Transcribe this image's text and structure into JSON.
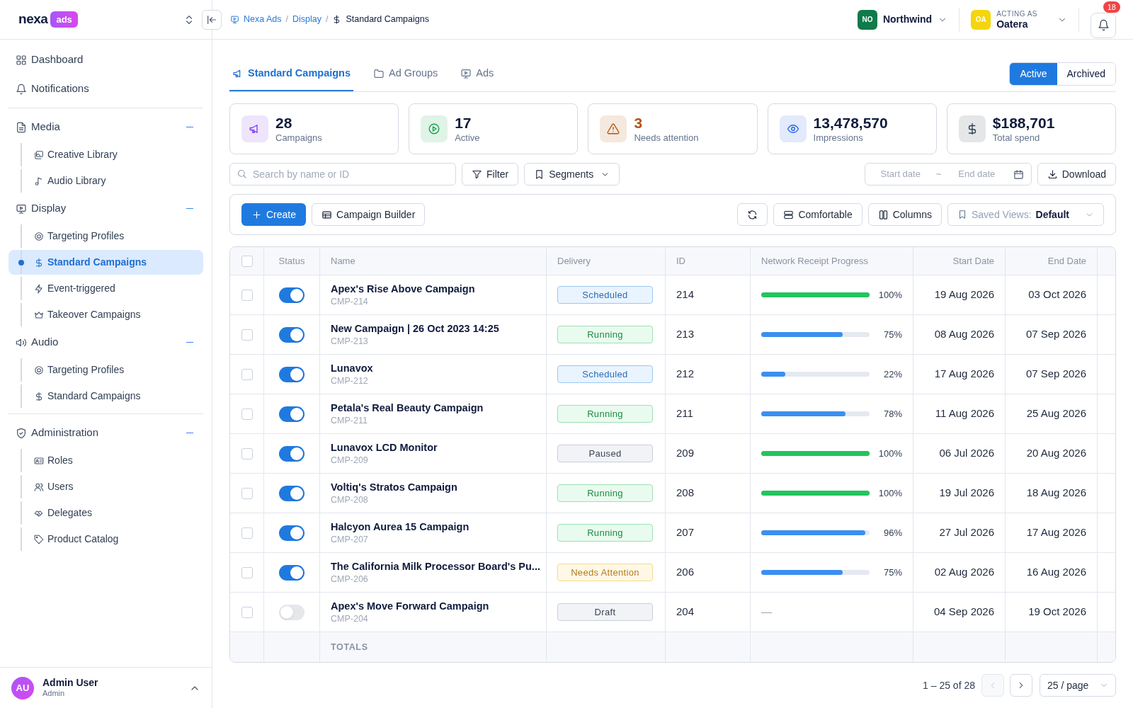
{
  "brand": {
    "name": "nexa",
    "badge": "ads"
  },
  "breadcrumb": [
    "Nexa Ads",
    "Display",
    "Standard Campaigns"
  ],
  "breadcrumb_separator": "/",
  "org": {
    "initials": "NO",
    "name": "Northwind",
    "color": "#0f7a4a"
  },
  "acting_as": {
    "initials": "OA",
    "caption": "ACTING AS",
    "name": "Oatera",
    "color": "#f5d50b"
  },
  "notifications": {
    "count": "18"
  },
  "sidebar": {
    "groups": [
      [
        {
          "label": "Dashboard",
          "selected": false
        },
        {
          "label": "Notifications",
          "selected": false
        }
      ],
      [
        {
          "label": "Media",
          "selected": false,
          "expanded": true,
          "children": [
            {
              "label": "Creative Library",
              "selected": false
            },
            {
              "label": "Audio Library",
              "selected": false
            }
          ]
        },
        {
          "label": "Display",
          "selected": false,
          "expanded": true,
          "children": [
            {
              "label": "Targeting Profiles",
              "selected": false
            },
            {
              "label": "Standard Campaigns",
              "selected": true
            },
            {
              "label": "Event-triggered",
              "selected": false
            },
            {
              "label": "Takeover Campaigns",
              "selected": false
            }
          ]
        },
        {
          "label": "Audio",
          "selected": false,
          "expanded": true,
          "children": [
            {
              "label": "Targeting Profiles",
              "selected": false
            },
            {
              "label": "Standard Campaigns",
              "selected": false
            }
          ]
        }
      ],
      [
        {
          "label": "Administration",
          "selected": false,
          "expanded": true,
          "children": [
            {
              "label": "Roles",
              "selected": false
            },
            {
              "label": "Users",
              "selected": false
            },
            {
              "label": "Delegates",
              "selected": false
            },
            {
              "label": "Product Catalog",
              "selected": false
            }
          ]
        }
      ]
    ],
    "user": {
      "initials": "AU",
      "name": "Admin User",
      "role": "Admin"
    }
  },
  "tabs": [
    {
      "label": "Standard Campaigns",
      "selected": true
    },
    {
      "label": "Ad Groups",
      "selected": false
    },
    {
      "label": "Ads",
      "selected": false
    }
  ],
  "archive_toggle": [
    {
      "label": "Active",
      "selected": true
    },
    {
      "label": "Archived",
      "selected": false
    }
  ],
  "stats": [
    {
      "value": "28",
      "label": "Campaigns",
      "color": "#7c3aed",
      "emphasis": false
    },
    {
      "value": "17",
      "label": "Active",
      "color": "#16a34a",
      "emphasis": false
    },
    {
      "value": "3",
      "label": "Needs attention",
      "color": "#b45309",
      "emphasis": true
    },
    {
      "value": "13,478,570",
      "label": "Impressions",
      "color": "#2563eb",
      "emphasis": false
    },
    {
      "value": "$188,701",
      "label": "Total spend",
      "color": "#334155",
      "emphasis": false
    }
  ],
  "filters": {
    "search": {
      "placeholder": "Search by name or ID"
    },
    "filter": "Filter",
    "segments": "Segments",
    "start_date": {
      "placeholder": "Start date"
    },
    "separator": "~",
    "end_date": {
      "placeholder": "End date"
    },
    "download": "Download"
  },
  "toolbar": {
    "create": "Create",
    "builder": "Campaign Builder",
    "density": "Comfortable",
    "columns": "Columns",
    "saved_views_label": "Saved Views:",
    "saved_views_value": "Default"
  },
  "table": {
    "select_all_checked": false,
    "columns": [
      "Status",
      "Name",
      "Delivery",
      "ID",
      "Network Receipt Progress",
      "Start Date",
      "End Date"
    ],
    "rows": [
      {
        "checked": false,
        "on": true,
        "name": "Apex's Rise Above Campaign",
        "code": "CMP-214",
        "delivery": {
          "kind": "scheduled",
          "label": "Scheduled"
        },
        "id": "214",
        "progress": {
          "level": 1,
          "reading": "100%"
        },
        "start": "19 Aug 2026",
        "end": "03 Oct 2026"
      },
      {
        "checked": false,
        "on": true,
        "name": "New Campaign | 26 Oct 2023 14:25",
        "code": "CMP-213",
        "delivery": {
          "kind": "running",
          "label": "Running"
        },
        "id": "213",
        "progress": {
          "level": 0.75,
          "reading": "75%"
        },
        "start": "08 Aug 2026",
        "end": "07 Sep 2026"
      },
      {
        "checked": false,
        "on": true,
        "name": "Lunavox",
        "code": "CMP-212",
        "delivery": {
          "kind": "scheduled",
          "label": "Scheduled"
        },
        "id": "212",
        "progress": {
          "level": 0.22,
          "reading": "22%"
        },
        "start": "17 Aug 2026",
        "end": "07 Sep 2026"
      },
      {
        "checked": false,
        "on": true,
        "name": "Petala's Real Beauty Campaign",
        "code": "CMP-211",
        "delivery": {
          "kind": "running",
          "label": "Running"
        },
        "id": "211",
        "progress": {
          "level": 0.78,
          "reading": "78%"
        },
        "start": "11 Aug 2026",
        "end": "25 Aug 2026"
      },
      {
        "checked": false,
        "on": true,
        "name": "Lunavox LCD Monitor",
        "code": "CMP-209",
        "delivery": {
          "kind": "paused",
          "label": "Paused"
        },
        "id": "209",
        "progress": {
          "level": 1,
          "reading": "100%"
        },
        "start": "06 Jul 2026",
        "end": "20 Aug 2026"
      },
      {
        "checked": false,
        "on": true,
        "name": "Voltiq's Stratos Campaign",
        "code": "CMP-208",
        "delivery": {
          "kind": "running",
          "label": "Running"
        },
        "id": "208",
        "progress": {
          "level": 1,
          "reading": "100%"
        },
        "start": "19 Jul 2026",
        "end": "18 Aug 2026"
      },
      {
        "checked": false,
        "on": true,
        "name": "Halcyon Aurea 15 Campaign",
        "code": "CMP-207",
        "delivery": {
          "kind": "running",
          "label": "Running"
        },
        "id": "207",
        "progress": {
          "level": 0.96,
          "reading": "96%"
        },
        "start": "27 Jul 2026",
        "end": "17 Aug 2026"
      },
      {
        "checked": false,
        "on": true,
        "name": "The California Milk Processor Board's Pu...",
        "code": "CMP-206",
        "delivery": {
          "kind": "needs_attention",
          "label": "Needs Attention"
        },
        "id": "206",
        "progress": {
          "level": 0.75,
          "reading": "75%"
        },
        "start": "02 Aug 2026",
        "end": "16 Aug 2026"
      },
      {
        "checked": false,
        "on": false,
        "name": "Apex's Move Forward Campaign",
        "code": "CMP-204",
        "delivery": {
          "kind": "draft",
          "label": "Draft"
        },
        "id": "204",
        "progress_empty": "—",
        "start": "04 Sep 2026",
        "end": "19 Oct 2026"
      }
    ],
    "totals_label": "TOTALS"
  },
  "pagination": {
    "range": "1 – 25 of 28",
    "prev_disabled": true,
    "page_size": "25 / page"
  }
}
